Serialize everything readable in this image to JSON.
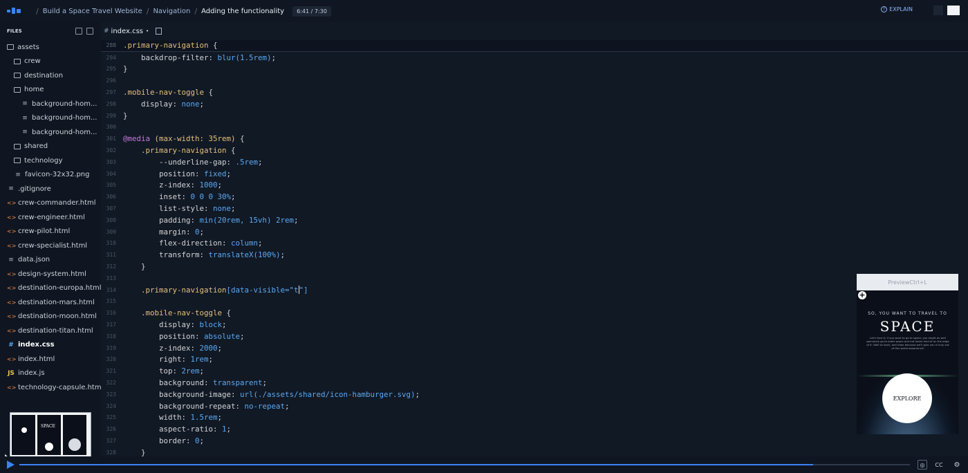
{
  "breadcrumb": {
    "course": "Build a Space Travel Website",
    "section": "Navigation",
    "lesson": "Adding the functionality",
    "time": "6:41 / 7:30"
  },
  "explain_label": "EXPLAIN",
  "sidebar": {
    "header": "FILES",
    "items": [
      {
        "label": "assets",
        "type": "folder",
        "depth": 0
      },
      {
        "label": "crew",
        "type": "folder",
        "depth": 1
      },
      {
        "label": "destination",
        "type": "folder",
        "depth": 1
      },
      {
        "label": "home",
        "type": "folder",
        "depth": 1
      },
      {
        "label": "background-hom...",
        "type": "file",
        "depth": 2
      },
      {
        "label": "background-hom...",
        "type": "file",
        "depth": 2
      },
      {
        "label": "background-hom...",
        "type": "file",
        "depth": 2
      },
      {
        "label": "shared",
        "type": "folder",
        "depth": 1
      },
      {
        "label": "technology",
        "type": "folder",
        "depth": 1
      },
      {
        "label": "favicon-32x32.png",
        "type": "file",
        "depth": 1
      },
      {
        "label": ".gitignore",
        "type": "file",
        "depth": 0
      },
      {
        "label": "crew-commander.html",
        "type": "html",
        "depth": 0
      },
      {
        "label": "crew-engineer.html",
        "type": "html",
        "depth": 0
      },
      {
        "label": "crew-pilot.html",
        "type": "html",
        "depth": 0
      },
      {
        "label": "crew-specialist.html",
        "type": "html",
        "depth": 0
      },
      {
        "label": "data.json",
        "type": "file",
        "depth": 0
      },
      {
        "label": "design-system.html",
        "type": "html",
        "depth": 0
      },
      {
        "label": "destination-europa.html",
        "type": "html",
        "depth": 0
      },
      {
        "label": "destination-mars.html",
        "type": "html",
        "depth": 0
      },
      {
        "label": "destination-moon.html",
        "type": "html",
        "depth": 0
      },
      {
        "label": "destination-titan.html",
        "type": "html",
        "depth": 0
      },
      {
        "label": "index.css",
        "type": "css",
        "depth": 0,
        "active": true
      },
      {
        "label": "index.html",
        "type": "html",
        "depth": 0
      },
      {
        "label": "index.js",
        "type": "js",
        "depth": 0
      },
      {
        "label": "technology-capsule.html",
        "type": "html",
        "depth": 0
      }
    ],
    "thumbnail_title": "SPACE"
  },
  "editor": {
    "tab_name": "index.css",
    "tab_modified": "•",
    "lines": [
      {
        "n": "288",
        "hl": true,
        "parts": [
          [
            "sel",
            ".primary-navigation "
          ],
          [
            "txt",
            "{"
          ]
        ]
      },
      {
        "n": "294",
        "parts": [
          [
            "txt",
            "    "
          ],
          [
            "prop",
            "backdrop-filter: "
          ],
          [
            "val",
            "blur(1.5rem)"
          ],
          [
            "txt",
            ";"
          ]
        ]
      },
      {
        "n": "295",
        "parts": [
          [
            "txt",
            "}"
          ]
        ]
      },
      {
        "n": "296",
        "parts": []
      },
      {
        "n": "297",
        "parts": [
          [
            "sel",
            ".mobile-nav-toggle "
          ],
          [
            "txt",
            "{"
          ]
        ]
      },
      {
        "n": "298",
        "parts": [
          [
            "txt",
            "    "
          ],
          [
            "prop",
            "display: "
          ],
          [
            "val",
            "none"
          ],
          [
            "txt",
            ";"
          ]
        ]
      },
      {
        "n": "299",
        "parts": [
          [
            "txt",
            "}"
          ]
        ]
      },
      {
        "n": "300",
        "parts": []
      },
      {
        "n": "301",
        "parts": [
          [
            "at",
            "@media "
          ],
          [
            "sel",
            "(max-width: 35rem) "
          ],
          [
            "txt",
            "{"
          ]
        ]
      },
      {
        "n": "302",
        "parts": [
          [
            "txt",
            "    "
          ],
          [
            "sel",
            ".primary-navigation "
          ],
          [
            "txt",
            "{"
          ]
        ]
      },
      {
        "n": "303",
        "parts": [
          [
            "txt",
            "        "
          ],
          [
            "prop",
            "--underline-gap: "
          ],
          [
            "val",
            ".5rem"
          ],
          [
            "txt",
            ";"
          ]
        ]
      },
      {
        "n": "304",
        "parts": [
          [
            "txt",
            "        "
          ],
          [
            "prop",
            "position: "
          ],
          [
            "val",
            "fixed"
          ],
          [
            "txt",
            ";"
          ]
        ]
      },
      {
        "n": "305",
        "parts": [
          [
            "txt",
            "        "
          ],
          [
            "prop",
            "z-index: "
          ],
          [
            "val",
            "1000"
          ],
          [
            "txt",
            ";"
          ]
        ]
      },
      {
        "n": "306",
        "parts": [
          [
            "txt",
            "        "
          ],
          [
            "prop",
            "inset: "
          ],
          [
            "val",
            "0 0 0 30%"
          ],
          [
            "txt",
            ";"
          ]
        ]
      },
      {
        "n": "307",
        "parts": [
          [
            "txt",
            "        "
          ],
          [
            "prop",
            "list-style: "
          ],
          [
            "val",
            "none"
          ],
          [
            "txt",
            ";"
          ]
        ]
      },
      {
        "n": "308",
        "parts": [
          [
            "txt",
            "        "
          ],
          [
            "prop",
            "padding: "
          ],
          [
            "val",
            "min(20rem, 15vh) 2rem"
          ],
          [
            "txt",
            ";"
          ]
        ]
      },
      {
        "n": "309",
        "parts": [
          [
            "txt",
            "        "
          ],
          [
            "prop",
            "margin: "
          ],
          [
            "val",
            "0"
          ],
          [
            "txt",
            ";"
          ]
        ]
      },
      {
        "n": "310",
        "parts": [
          [
            "txt",
            "        "
          ],
          [
            "prop",
            "flex-direction: "
          ],
          [
            "val",
            "column"
          ],
          [
            "txt",
            ";"
          ]
        ]
      },
      {
        "n": "311",
        "parts": [
          [
            "txt",
            "        "
          ],
          [
            "prop",
            "transform: "
          ],
          [
            "val",
            "translateX(100%)"
          ],
          [
            "txt",
            ";"
          ]
        ]
      },
      {
        "n": "312",
        "parts": [
          [
            "txt",
            "    }"
          ]
        ]
      },
      {
        "n": "313",
        "parts": []
      },
      {
        "n": "314",
        "parts": [
          [
            "txt",
            "    "
          ],
          [
            "sel",
            ".primary-navigation"
          ],
          [
            "val",
            "[data-visible=\"t"
          ],
          [
            "caret",
            ""
          ],
          [
            "val",
            "\"]"
          ]
        ]
      },
      {
        "n": "315",
        "parts": []
      },
      {
        "n": "316",
        "parts": [
          [
            "txt",
            "    "
          ],
          [
            "sel",
            ".mobile-nav-toggle "
          ],
          [
            "txt",
            "{"
          ]
        ]
      },
      {
        "n": "317",
        "parts": [
          [
            "txt",
            "        "
          ],
          [
            "prop",
            "display: "
          ],
          [
            "val",
            "block"
          ],
          [
            "txt",
            ";"
          ]
        ]
      },
      {
        "n": "318",
        "parts": [
          [
            "txt",
            "        "
          ],
          [
            "prop",
            "position: "
          ],
          [
            "val",
            "absolute"
          ],
          [
            "txt",
            ";"
          ]
        ]
      },
      {
        "n": "319",
        "parts": [
          [
            "txt",
            "        "
          ],
          [
            "prop",
            "z-index: "
          ],
          [
            "val",
            "2000"
          ],
          [
            "txt",
            ";"
          ]
        ]
      },
      {
        "n": "320",
        "parts": [
          [
            "txt",
            "        "
          ],
          [
            "prop",
            "right: "
          ],
          [
            "val",
            "1rem"
          ],
          [
            "txt",
            ";"
          ]
        ]
      },
      {
        "n": "321",
        "parts": [
          [
            "txt",
            "        "
          ],
          [
            "prop",
            "top: "
          ],
          [
            "val",
            "2rem"
          ],
          [
            "txt",
            ";"
          ]
        ]
      },
      {
        "n": "322",
        "parts": [
          [
            "txt",
            "        "
          ],
          [
            "prop",
            "background: "
          ],
          [
            "val",
            "transparent"
          ],
          [
            "txt",
            ";"
          ]
        ]
      },
      {
        "n": "323",
        "parts": [
          [
            "txt",
            "        "
          ],
          [
            "prop",
            "background-image: "
          ],
          [
            "val",
            "url(./assets/shared/icon-hamburger.svg)"
          ],
          [
            "txt",
            ";"
          ]
        ]
      },
      {
        "n": "324",
        "parts": [
          [
            "txt",
            "        "
          ],
          [
            "prop",
            "background-repeat: "
          ],
          [
            "val",
            "no-repeat"
          ],
          [
            "txt",
            ";"
          ]
        ]
      },
      {
        "n": "325",
        "parts": [
          [
            "txt",
            "        "
          ],
          [
            "prop",
            "width: "
          ],
          [
            "val",
            "1.5rem"
          ],
          [
            "txt",
            ";"
          ]
        ]
      },
      {
        "n": "326",
        "parts": [
          [
            "txt",
            "        "
          ],
          [
            "prop",
            "aspect-ratio: "
          ],
          [
            "val",
            "1"
          ],
          [
            "txt",
            ";"
          ]
        ]
      },
      {
        "n": "327",
        "parts": [
          [
            "txt",
            "        "
          ],
          [
            "prop",
            "border: "
          ],
          [
            "val",
            "0"
          ],
          [
            "txt",
            ";"
          ]
        ]
      },
      {
        "n": "328",
        "parts": [
          [
            "txt",
            "    }"
          ]
        ]
      }
    ]
  },
  "preview": {
    "header": "PreviewCtrl+L",
    "tagline": "SO, YOU WANT TO TRAVEL TO",
    "title": "SPACE",
    "body": "Let's face it; if you want to go to space, you might as well genuinely go to outer space and not hover kind of on the edge of it. Well sit back, and relax because we'll give you a truly out of this world experience!",
    "button": "EXPLORE"
  },
  "player": {
    "progress": 0.8913,
    "cc_label": "CC"
  },
  "colors": {
    "accent": "#3b82f6",
    "selector": "#e5c07b",
    "value": "#5aa9f3"
  }
}
